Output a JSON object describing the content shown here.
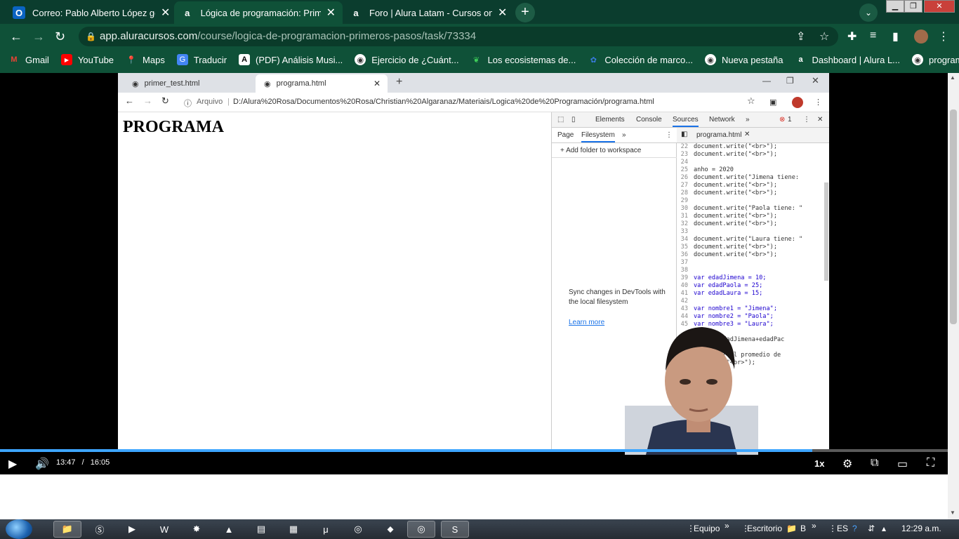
{
  "outer_browser": {
    "tabs": [
      {
        "label": "Correo: Pablo Alberto López gon",
        "icon": "outlook-icon",
        "active": false
      },
      {
        "label": "Lógica de programación: Primero",
        "icon": "alura-icon",
        "active": true
      },
      {
        "label": "Foro | Alura Latam - Cursos onlin",
        "icon": "alura-icon",
        "active": false
      }
    ],
    "url_host": "app.aluracursos.com",
    "url_path": "/course/logica-de-programacion-primeros-pasos/task/73334",
    "bookmarks": [
      {
        "label": "Gmail",
        "icon": "gmail-icon"
      },
      {
        "label": "YouTube",
        "icon": "youtube-icon"
      },
      {
        "label": "Maps",
        "icon": "maps-icon"
      },
      {
        "label": "Traducir",
        "icon": "translate-icon"
      },
      {
        "label": "(PDF) Análisis Musi...",
        "icon": "academia-icon"
      },
      {
        "label": "Ejercicio de ¿Cuánt...",
        "icon": "globe-icon"
      },
      {
        "label": "Los ecosistemas de...",
        "icon": "leaf-icon"
      },
      {
        "label": "Colección de marco...",
        "icon": "gear-blue-icon"
      },
      {
        "label": "Nueva pestaña",
        "icon": "globe-icon"
      },
      {
        "label": "Dashboard | Alura L...",
        "icon": "alura-icon"
      },
      {
        "label": "programa.html",
        "icon": "globe-icon"
      }
    ]
  },
  "inner_browser": {
    "tabs": [
      {
        "label": "primer_test.html"
      },
      {
        "label": "programa.html"
      }
    ],
    "address_prefix": "Arquivo",
    "address": "D:/Alura%20Rosa/Documentos%20Rosa/Christian%20Algaranaz/Materiais/Logica%20de%20Programación/programa.html",
    "page_heading": "PROGRAMA"
  },
  "devtools": {
    "panels": [
      "Elements",
      "Console",
      "Sources",
      "Network"
    ],
    "error_count": "1",
    "nav_tabs": [
      "Page",
      "Filesystem"
    ],
    "add_folder": "+ Add folder to workspace",
    "sync_text": "Sync changes in DevTools with the local filesystem",
    "learn_more": "Learn more",
    "editor_file": "programa.html",
    "code_lines": [
      {
        "n": "22",
        "t": "document.write(\"<br>\");"
      },
      {
        "n": "23",
        "t": "document.write(\"<br>\");"
      },
      {
        "n": "24",
        "t": ""
      },
      {
        "n": "25",
        "t": "anho = 2020"
      },
      {
        "n": "26",
        "t": "document.write(\"Jimena tiene: "
      },
      {
        "n": "27",
        "t": "document.write(\"<br>\");"
      },
      {
        "n": "28",
        "t": "document.write(\"<br>\");"
      },
      {
        "n": "29",
        "t": ""
      },
      {
        "n": "30",
        "t": "document.write(\"Paola tiene: \""
      },
      {
        "n": "31",
        "t": "document.write(\"<br>\");"
      },
      {
        "n": "32",
        "t": "document.write(\"<br>\");"
      },
      {
        "n": "33",
        "t": ""
      },
      {
        "n": "34",
        "t": "document.write(\"Laura tiene: \""
      },
      {
        "n": "35",
        "t": "document.write(\"<br>\");"
      },
      {
        "n": "36",
        "t": "document.write(\"<br>\");"
      },
      {
        "n": "37",
        "t": ""
      },
      {
        "n": "38",
        "t": ""
      },
      {
        "n": "39",
        "t": "var edadJimena = 10;"
      },
      {
        "n": "40",
        "t": "var edadPaola = 25;"
      },
      {
        "n": "41",
        "t": "var edadLaura = 15;"
      },
      {
        "n": "42",
        "t": ""
      },
      {
        "n": "43",
        "t": "var nombre1 = \"Jimena\";"
      },
      {
        "n": "44",
        "t": "var nombre2 = \"Paola\";"
      },
      {
        "n": "45",
        "t": "var nombre3 = \"Laura\";"
      },
      {
        "n": "",
        "t": ""
      },
      {
        "n": "",
        "t": "    = (edadJimena+edadPac"
      },
      {
        "n": "",
        "t": ""
      },
      {
        "n": "",
        "t": "   write(\"El promedio de"
      },
      {
        "n": "",
        "t": "   write(\"<br>\");"
      }
    ]
  },
  "video": {
    "current_time": "13:47",
    "separator": "/",
    "duration": "16:05",
    "progress": 0.857,
    "speed": "1x"
  },
  "taskbar": {
    "tray_equipo": "Equipo",
    "tray_escritorio": "Escritorio",
    "tray_b": "B",
    "lang": "ES",
    "clock": "12:29 a.m."
  }
}
